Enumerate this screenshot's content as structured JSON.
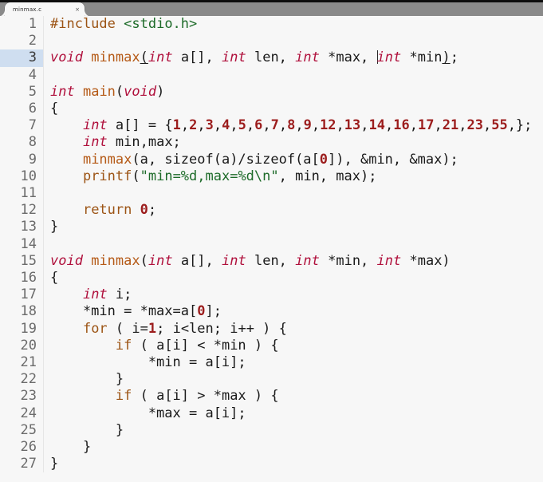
{
  "window": {
    "tab": {
      "label": "minmax.c",
      "close_label": "×"
    }
  },
  "editor": {
    "current_line": 3,
    "caret_line": 3,
    "filename": "minmax.c",
    "language": "C",
    "total_lines": 27,
    "colors": {
      "background": "#f7f7f7",
      "gutter_text": "#6b6b6b",
      "current_line_highlight": "#cfdef0",
      "keyword": "#b0103c",
      "control": "#9c5415",
      "function": "#b55a17",
      "string": "#1d6b29",
      "header": "#1d6b29",
      "number": "#9c1d1d",
      "plain": "#1a1a1a",
      "titlebar": "#8a8a8a"
    },
    "lines": [
      {
        "n": "1",
        "text": "#include <stdio.h>"
      },
      {
        "n": "2",
        "text": ""
      },
      {
        "n": "3",
        "text": "void minmax(int a[], int len, int *max, int *min);"
      },
      {
        "n": "4",
        "text": ""
      },
      {
        "n": "5",
        "text": "int main(void)"
      },
      {
        "n": "6",
        "text": "{"
      },
      {
        "n": "7",
        "text": "    int a[] = {1,2,3,4,5,6,7,8,9,12,13,14,16,17,21,23,55,};"
      },
      {
        "n": "8",
        "text": "    int min,max;"
      },
      {
        "n": "9",
        "text": "    minmax(a, sizeof(a)/sizeof(a[0]), &min, &max);"
      },
      {
        "n": "10",
        "text": "    printf(\"min=%d,max=%d\\n\", min, max);"
      },
      {
        "n": "11",
        "text": ""
      },
      {
        "n": "12",
        "text": "    return 0;"
      },
      {
        "n": "13",
        "text": "}"
      },
      {
        "n": "14",
        "text": ""
      },
      {
        "n": "15",
        "text": "void minmax(int a[], int len, int *min, int *max)"
      },
      {
        "n": "16",
        "text": "{"
      },
      {
        "n": "17",
        "text": "    int i;"
      },
      {
        "n": "18",
        "text": "    *min = *max=a[0];"
      },
      {
        "n": "19",
        "text": "    for ( i=1; i<len; i++ ) {"
      },
      {
        "n": "20",
        "text": "        if ( a[i] < *min ) {"
      },
      {
        "n": "21",
        "text": "            *min = a[i];"
      },
      {
        "n": "22",
        "text": "        }"
      },
      {
        "n": "23",
        "text": "        if ( a[i] > *max ) {"
      },
      {
        "n": "24",
        "text": "            *max = a[i];"
      },
      {
        "n": "25",
        "text": "        }"
      },
      {
        "n": "26",
        "text": "    }"
      },
      {
        "n": "27",
        "text": "}"
      }
    ],
    "tokens": [
      [
        {
          "c": "pre",
          "t": "#include"
        },
        {
          "c": "plain",
          "t": " "
        },
        {
          "c": "hdr",
          "t": "<stdio.h>"
        }
      ],
      [],
      [
        {
          "c": "kw",
          "t": "void"
        },
        {
          "c": "plain",
          "t": " "
        },
        {
          "c": "fn",
          "t": "minmax"
        },
        {
          "c": "ul",
          "t": "("
        },
        {
          "c": "kw",
          "t": "int"
        },
        {
          "c": "plain",
          "t": " a[], "
        },
        {
          "c": "kw",
          "t": "int"
        },
        {
          "c": "plain",
          "t": " len, "
        },
        {
          "c": "kw",
          "t": "int"
        },
        {
          "c": "plain",
          "t": " *max, "
        },
        {
          "c": "caret",
          "t": ""
        },
        {
          "c": "kw",
          "t": "int"
        },
        {
          "c": "plain",
          "t": " *min"
        },
        {
          "c": "ul",
          "t": ")"
        },
        {
          "c": "plain",
          "t": ";"
        }
      ],
      [],
      [
        {
          "c": "kw",
          "t": "int"
        },
        {
          "c": "plain",
          "t": " "
        },
        {
          "c": "fn",
          "t": "main"
        },
        {
          "c": "plain",
          "t": "("
        },
        {
          "c": "kw",
          "t": "void"
        },
        {
          "c": "plain",
          "t": ")"
        }
      ],
      [
        {
          "c": "plain",
          "t": "{"
        }
      ],
      [
        {
          "c": "plain",
          "t": "    "
        },
        {
          "c": "kw",
          "t": "int"
        },
        {
          "c": "plain",
          "t": " a[] = {"
        },
        {
          "c": "num",
          "t": "1"
        },
        {
          "c": "plain",
          "t": ","
        },
        {
          "c": "num",
          "t": "2"
        },
        {
          "c": "plain",
          "t": ","
        },
        {
          "c": "num",
          "t": "3"
        },
        {
          "c": "plain",
          "t": ","
        },
        {
          "c": "num",
          "t": "4"
        },
        {
          "c": "plain",
          "t": ","
        },
        {
          "c": "num",
          "t": "5"
        },
        {
          "c": "plain",
          "t": ","
        },
        {
          "c": "num",
          "t": "6"
        },
        {
          "c": "plain",
          "t": ","
        },
        {
          "c": "num",
          "t": "7"
        },
        {
          "c": "plain",
          "t": ","
        },
        {
          "c": "num",
          "t": "8"
        },
        {
          "c": "plain",
          "t": ","
        },
        {
          "c": "num",
          "t": "9"
        },
        {
          "c": "plain",
          "t": ","
        },
        {
          "c": "num",
          "t": "12"
        },
        {
          "c": "plain",
          "t": ","
        },
        {
          "c": "num",
          "t": "13"
        },
        {
          "c": "plain",
          "t": ","
        },
        {
          "c": "num",
          "t": "14"
        },
        {
          "c": "plain",
          "t": ","
        },
        {
          "c": "num",
          "t": "16"
        },
        {
          "c": "plain",
          "t": ","
        },
        {
          "c": "num",
          "t": "17"
        },
        {
          "c": "plain",
          "t": ","
        },
        {
          "c": "num",
          "t": "21"
        },
        {
          "c": "plain",
          "t": ","
        },
        {
          "c": "num",
          "t": "23"
        },
        {
          "c": "plain",
          "t": ","
        },
        {
          "c": "num",
          "t": "55"
        },
        {
          "c": "plain",
          "t": ",};"
        }
      ],
      [
        {
          "c": "plain",
          "t": "    "
        },
        {
          "c": "kw",
          "t": "int"
        },
        {
          "c": "plain",
          "t": " min,max;"
        }
      ],
      [
        {
          "c": "plain",
          "t": "    "
        },
        {
          "c": "fn",
          "t": "minmax"
        },
        {
          "c": "plain",
          "t": "(a, sizeof(a)/sizeof(a["
        },
        {
          "c": "num",
          "t": "0"
        },
        {
          "c": "plain",
          "t": "]), &min, &max);"
        }
      ],
      [
        {
          "c": "plain",
          "t": "    "
        },
        {
          "c": "ctrl",
          "t": "printf"
        },
        {
          "c": "plain",
          "t": "("
        },
        {
          "c": "str",
          "t": "\"min=%d,max=%d\\n\""
        },
        {
          "c": "plain",
          "t": ", min, max);"
        }
      ],
      [],
      [
        {
          "c": "plain",
          "t": "    "
        },
        {
          "c": "ctrl",
          "t": "return"
        },
        {
          "c": "plain",
          "t": " "
        },
        {
          "c": "num",
          "t": "0"
        },
        {
          "c": "plain",
          "t": ";"
        }
      ],
      [
        {
          "c": "plain",
          "t": "}"
        }
      ],
      [],
      [
        {
          "c": "kw",
          "t": "void"
        },
        {
          "c": "plain",
          "t": " "
        },
        {
          "c": "fn",
          "t": "minmax"
        },
        {
          "c": "plain",
          "t": "("
        },
        {
          "c": "kw",
          "t": "int"
        },
        {
          "c": "plain",
          "t": " a[], "
        },
        {
          "c": "kw",
          "t": "int"
        },
        {
          "c": "plain",
          "t": " len, "
        },
        {
          "c": "kw",
          "t": "int"
        },
        {
          "c": "plain",
          "t": " *min, "
        },
        {
          "c": "kw",
          "t": "int"
        },
        {
          "c": "plain",
          "t": " *max)"
        }
      ],
      [
        {
          "c": "plain",
          "t": "{"
        }
      ],
      [
        {
          "c": "plain",
          "t": "    "
        },
        {
          "c": "kw",
          "t": "int"
        },
        {
          "c": "plain",
          "t": " i;"
        }
      ],
      [
        {
          "c": "plain",
          "t": "    *min = *max=a["
        },
        {
          "c": "num",
          "t": "0"
        },
        {
          "c": "plain",
          "t": "];"
        }
      ],
      [
        {
          "c": "plain",
          "t": "    "
        },
        {
          "c": "ctrl",
          "t": "for"
        },
        {
          "c": "plain",
          "t": " ( i="
        },
        {
          "c": "num",
          "t": "1"
        },
        {
          "c": "plain",
          "t": "; i<len; i++ ) {"
        }
      ],
      [
        {
          "c": "plain",
          "t": "        "
        },
        {
          "c": "ctrl",
          "t": "if"
        },
        {
          "c": "plain",
          "t": " ( a[i] < *min ) {"
        }
      ],
      [
        {
          "c": "plain",
          "t": "            *min = a[i];"
        }
      ],
      [
        {
          "c": "plain",
          "t": "        }"
        }
      ],
      [
        {
          "c": "plain",
          "t": "        "
        },
        {
          "c": "ctrl",
          "t": "if"
        },
        {
          "c": "plain",
          "t": " ( a[i] > *max ) {"
        }
      ],
      [
        {
          "c": "plain",
          "t": "            *max = a[i];"
        }
      ],
      [
        {
          "c": "plain",
          "t": "        }"
        }
      ],
      [
        {
          "c": "plain",
          "t": "    }"
        }
      ],
      [
        {
          "c": "plain",
          "t": "}"
        }
      ]
    ]
  }
}
